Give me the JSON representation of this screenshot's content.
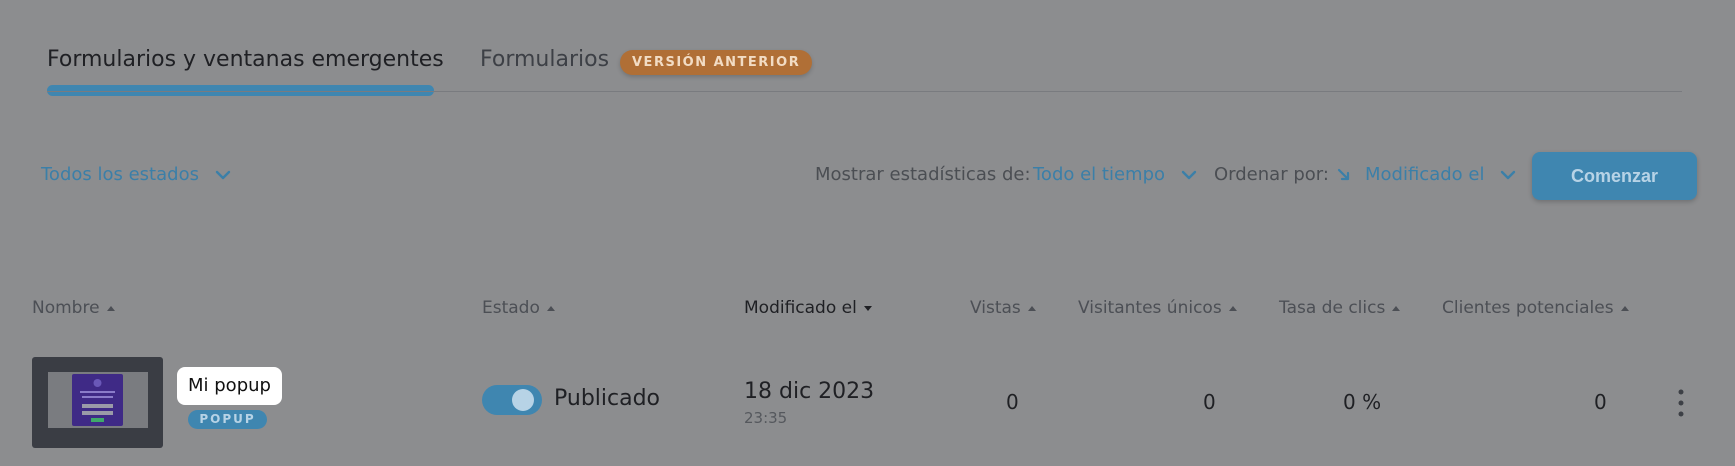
{
  "tabs": {
    "active_label": "Formularios y ventanas emergentes",
    "legacy_label": "Formularios",
    "legacy_badge": "VERSIÓN ANTERIOR"
  },
  "toolbar": {
    "status_filter": "Todos los estados",
    "stats_label": "Mostrar estadísticas de:",
    "stats_value": "Todo el tiempo",
    "sort_label": "Ordenar por:",
    "sort_value": "Modificado el",
    "start_button": "Comenzar"
  },
  "table": {
    "columns": [
      "Nombre",
      "Estado",
      "Modificado el",
      "Vistas",
      "Visitantes únicos",
      "Tasa de clics",
      "Clientes potenciales"
    ],
    "rows": [
      {
        "name": "Mi popup",
        "type": "POPUP",
        "status": "Publicado",
        "published": true,
        "modified_date": "18 dic 2023",
        "modified_time": "23:35",
        "views": "0",
        "unique_visitors": "0",
        "click_rate": "0 %",
        "leads": "0"
      }
    ]
  },
  "colors": {
    "accent": "#3f86b0",
    "badge_orange": "#b06f36",
    "overlay_bg": "#8c8d8f"
  }
}
